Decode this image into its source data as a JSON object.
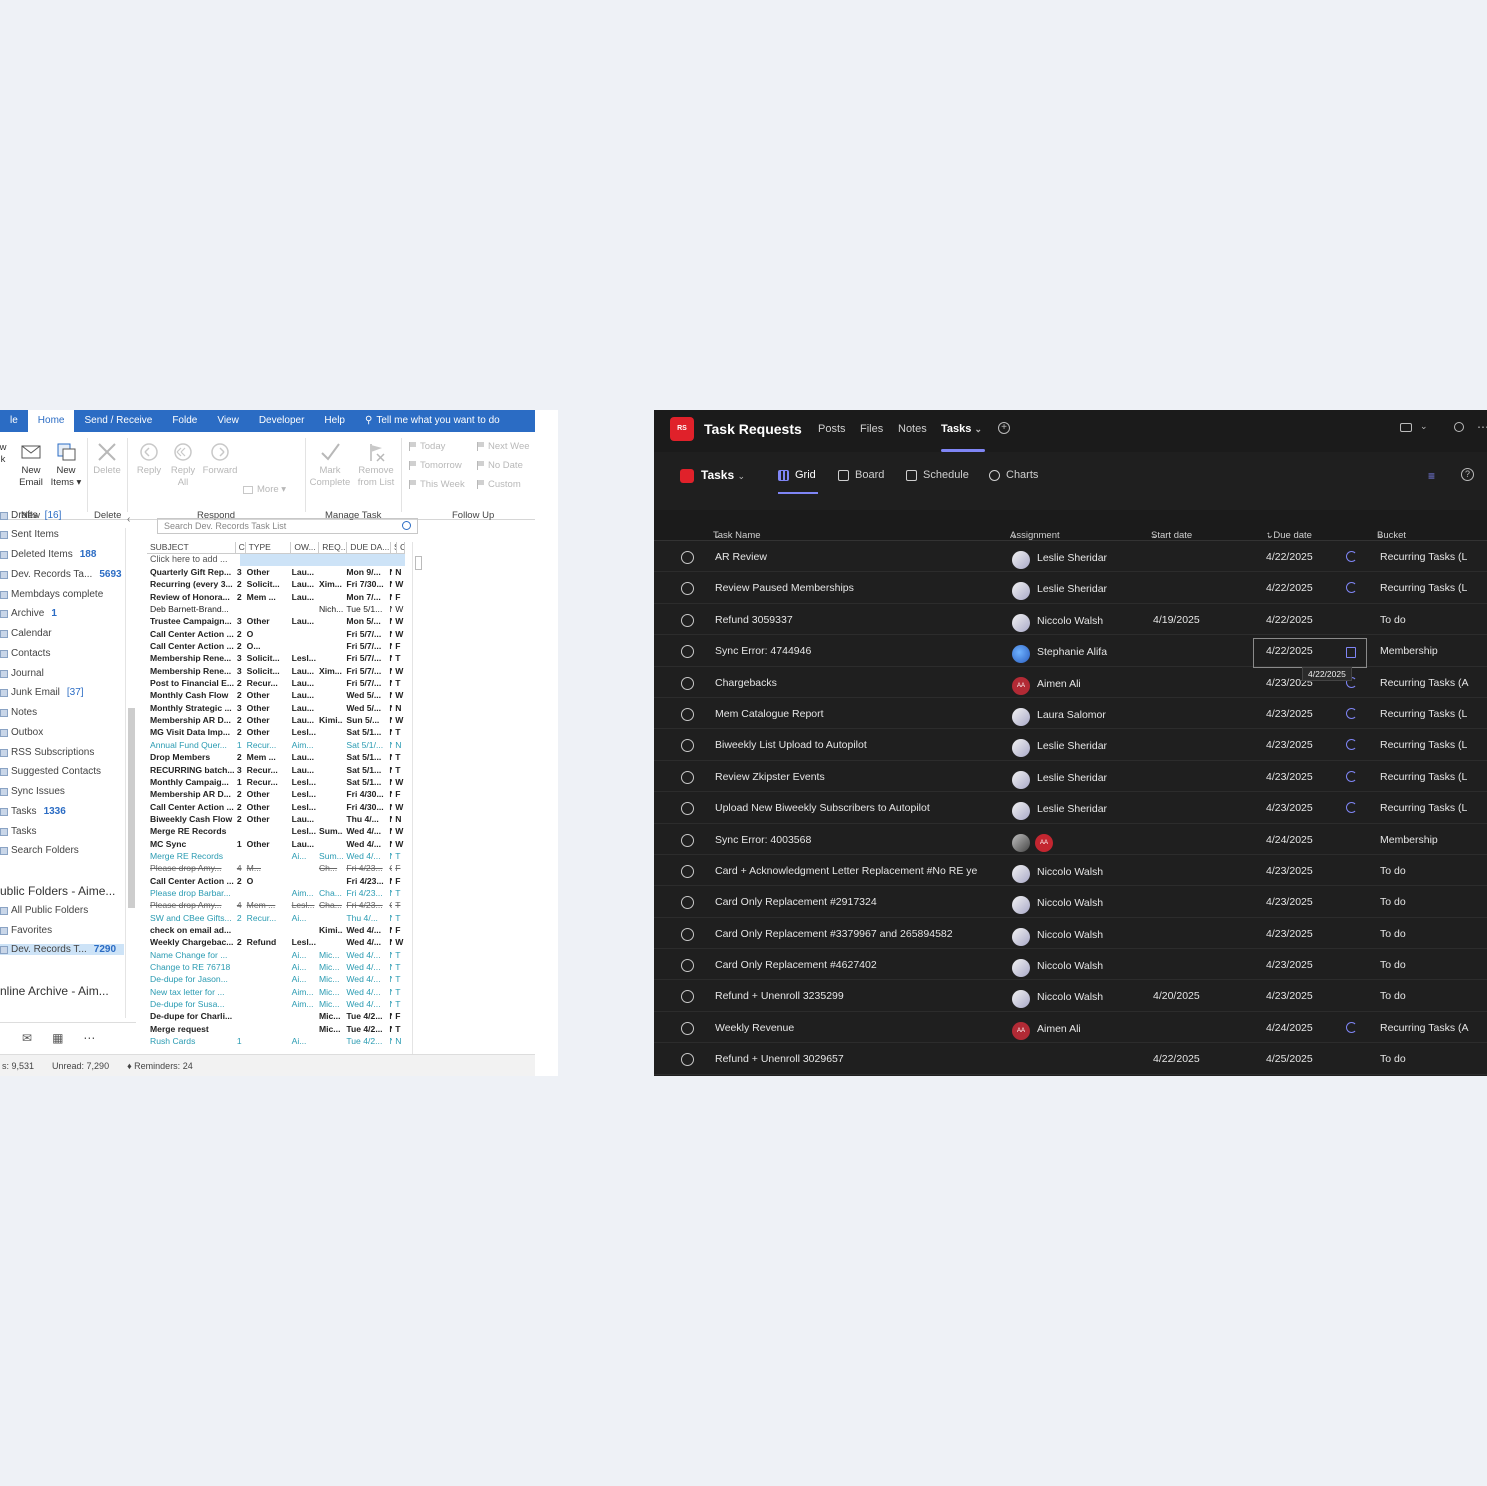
{
  "outlook": {
    "tabs": [
      "le",
      "Home",
      "Send / Receive",
      "Folde",
      "View",
      "Developer",
      "Help"
    ],
    "tell_me": "Tell me what you want to do",
    "ribbon": {
      "new_partial": "w\nk",
      "new_email": "New\nEmail",
      "new_items": "New\nItems ▾",
      "delete": "Delete",
      "reply": "Reply",
      "reply_all": "Reply\nAll",
      "forward": "Forward",
      "more": "More ▾",
      "mark_complete": "Mark\nComplete",
      "remove_from_list": "Remove\nfrom List",
      "today": "Today",
      "tomorrow": "Tomorrow",
      "this_week": "This Week",
      "next_week": "Next Wee",
      "no_date": "No Date",
      "custom": "Custom",
      "groups": [
        "New",
        "Delete",
        "Respond",
        "Manage Task",
        "Follow Up"
      ]
    },
    "folders": [
      {
        "label": "Drafts",
        "count": "[16]",
        "style": "br"
      },
      {
        "label": "Sent Items",
        "count": ""
      },
      {
        "label": "Deleted Items",
        "count": "188"
      },
      {
        "label": "Dev. Records Ta...",
        "count": "5693"
      },
      {
        "label": "Membdays complete",
        "count": ""
      },
      {
        "label": "Archive",
        "count": "1"
      },
      {
        "label": "Calendar",
        "count": ""
      },
      {
        "label": "Contacts",
        "count": ""
      },
      {
        "label": "Journal",
        "count": ""
      },
      {
        "label": "Junk Email",
        "count": "[37]",
        "style": "br"
      },
      {
        "label": "Notes",
        "count": ""
      },
      {
        "label": "Outbox",
        "count": ""
      },
      {
        "label": "RSS Subscriptions",
        "count": ""
      },
      {
        "label": "Suggested Contacts",
        "count": ""
      },
      {
        "label": "Sync Issues",
        "count": ""
      },
      {
        "label": "Tasks",
        "count": "1336"
      },
      {
        "label": "Tasks",
        "count": ""
      },
      {
        "label": "Search Folders",
        "count": ""
      }
    ],
    "public_header": "ublic Folders - Aime...",
    "public_folders": [
      {
        "label": "All Public Folders",
        "count": ""
      },
      {
        "label": "Favorites",
        "count": ""
      },
      {
        "label": "Dev. Records T...",
        "count": "7290"
      }
    ],
    "archive_header": "nline Archive - Aim...",
    "search_placeholder": "Search Dev. Records Task List",
    "columns": [
      "SUBJECT",
      "C",
      "TYPE",
      "OW...",
      "REQ...",
      "DUE DA...",
      "S",
      "C"
    ],
    "add_row": "Click here to add ...",
    "rows": [
      [
        "Quarterly Gift Rep...",
        "3",
        "Other",
        "Lau...",
        "",
        "Mon 9/...",
        "N",
        "N",
        "b"
      ],
      [
        "Recurring (every 3...",
        "2",
        "Solicit...",
        "Lau...",
        "Xim...",
        "Fri 7/30...",
        "N",
        "W",
        "b"
      ],
      [
        "Review of Honora...",
        "2",
        "Mem ...",
        "Lau...",
        "",
        "Mon 7/...",
        "N",
        "F",
        "b"
      ],
      [
        "Deb Barnett-Brand...",
        "",
        "",
        "",
        "Nich...",
        "Tue 5/1...",
        "N",
        "W",
        "n"
      ],
      [
        "Trustee Campaign...",
        "3",
        "Other",
        "Lau...",
        "",
        "Mon 5/...",
        "N",
        "W",
        "b"
      ],
      [
        "Call Center Action ...",
        "2",
        "O",
        "",
        "",
        "Fri 5/7/...",
        "N",
        "W",
        "b"
      ],
      [
        "Call Center Action ...",
        "2",
        "O...",
        "",
        "",
        "Fri 5/7/...",
        "N",
        "F",
        "b"
      ],
      [
        "Membership Rene...",
        "3",
        "Solicit...",
        "Lesl...",
        "",
        "Fri 5/7/...",
        "N",
        "T",
        "b"
      ],
      [
        "Membership Rene...",
        "3",
        "Solicit...",
        "Lau...",
        "Xim...",
        "Fri 5/7/...",
        "N",
        "W",
        "b"
      ],
      [
        "Post to Financial E...",
        "2",
        "Recur...",
        "Lau...",
        "",
        "Fri 5/7/...",
        "N",
        "T",
        "b"
      ],
      [
        "Monthly Cash Flow",
        "2",
        "Other",
        "Lau...",
        "",
        "Wed 5/...",
        "N",
        "W",
        "b"
      ],
      [
        "Monthly Strategic ...",
        "3",
        "Other",
        "Lau...",
        "",
        "Wed 5/...",
        "N",
        "N",
        "b"
      ],
      [
        "Membership AR D...",
        "2",
        "Other",
        "Lau...",
        "Kimi...",
        "Sun 5/...",
        "N",
        "W",
        "b"
      ],
      [
        "MG Visit Data Imp...",
        "2",
        "Other",
        "Lesl...",
        "",
        "Sat 5/1...",
        "N",
        "T",
        "b"
      ],
      [
        "Annual Fund Quer...",
        "1",
        "Recur...",
        "Aim...",
        "",
        "Sat 5/1/...",
        "N",
        "N",
        "t"
      ],
      [
        "Drop Members",
        "2",
        "Mem ...",
        "Lau...",
        "",
        "Sat 5/1...",
        "N",
        "T",
        "b"
      ],
      [
        "RECURRING batch...",
        "3",
        "Recur...",
        "Lau...",
        "",
        "Sat 5/1...",
        "N",
        "T",
        "b"
      ],
      [
        "Monthly Campaig...",
        "1",
        "Recur...",
        "Lesl...",
        "",
        "Sat 5/1...",
        "N",
        "W",
        "b"
      ],
      [
        "Membership AR D...",
        "2",
        "Other",
        "Lesl...",
        "",
        "Fri 4/30...",
        "N",
        "F",
        "b"
      ],
      [
        "Call Center Action ...",
        "2",
        "Other",
        "Lesl...",
        "",
        "Fri 4/30...",
        "N",
        "W",
        "b"
      ],
      [
        "Biweekly Cash Flow",
        "2",
        "Other",
        "Lau...",
        "",
        "Thu 4/...",
        "N",
        "N",
        "b"
      ],
      [
        "Merge RE Records",
        "",
        "",
        "Lesl...",
        "Sum...",
        "Wed 4/...",
        "N",
        "W",
        "b"
      ],
      [
        "MC Sync",
        "1",
        "Other",
        "Lau...",
        "",
        "Wed 4/...",
        "N",
        "W",
        "b"
      ],
      [
        "Merge RE Records",
        "",
        "",
        "Ai...",
        "Sum...",
        "Wed 4/...",
        "N",
        "T",
        "t"
      ],
      [
        "Please drop Amy...",
        "4",
        "M...",
        "",
        "Ch...",
        "Fri 4/23...",
        "C",
        "F",
        "s"
      ],
      [
        "Call Center Action ...",
        "2",
        "O",
        "",
        "",
        "Fri 4/23...",
        "N",
        "F",
        "b"
      ],
      [
        "Please drop Barbar...",
        "",
        "",
        "Aim...",
        "Cha...",
        "Fri 4/23...",
        "N",
        "T",
        "t"
      ],
      [
        "Please drop Amy...",
        "4",
        "Mem ...",
        "Lesl...",
        "Cha...",
        "Fri 4/23...",
        "C",
        "T",
        "s"
      ],
      [
        "SW and CBee Gifts...",
        "2",
        "Recur...",
        "Ai...",
        "",
        "Thu 4/...",
        "N",
        "T",
        "t"
      ],
      [
        "check on email ad...",
        "",
        "",
        "",
        "Kimi...",
        "Wed 4/...",
        "N",
        "F",
        "b"
      ],
      [
        "Weekly Chargebac...",
        "2",
        "Refund",
        "Lesl...",
        "",
        "Wed 4/...",
        "N",
        "W",
        "b"
      ],
      [
        "Name Change for ...",
        "",
        "",
        "Ai...",
        "Mic...",
        "Wed 4/...",
        "N",
        "T",
        "t"
      ],
      [
        "Change to RE 76718",
        "",
        "",
        "Ai...",
        "Mic...",
        "Wed 4/...",
        "N",
        "T",
        "t"
      ],
      [
        "De-dupe for Jason...",
        "",
        "",
        "Ai...",
        "Mic...",
        "Wed 4/...",
        "N",
        "T",
        "t"
      ],
      [
        "New tax letter for ...",
        "",
        "",
        "Aim...",
        "Mic...",
        "Wed 4/...",
        "N",
        "T",
        "t"
      ],
      [
        "De-dupe for Susa...",
        "",
        "",
        "Aim...",
        "Mic...",
        "Wed 4/...",
        "N",
        "T",
        "t"
      ],
      [
        "De-dupe for Charli...",
        "",
        "",
        "",
        "Mic...",
        "Tue 4/2...",
        "N",
        "F",
        "b"
      ],
      [
        "Merge request",
        "",
        "",
        "",
        "Mic...",
        "Tue 4/2...",
        "N",
        "T",
        "b"
      ],
      [
        "Rush Cards",
        "1",
        "",
        "Ai...",
        "",
        "Tue 4/2...",
        "N",
        "N",
        "t"
      ]
    ],
    "status": {
      "items": "s: 9,531",
      "unread": "Unread: 7,290",
      "reminders": "Reminders: 24"
    }
  },
  "teams": {
    "logo_text": "RS",
    "title": "Task Requests",
    "tabs": [
      "Posts",
      "Files",
      "Notes",
      "Tasks"
    ],
    "plan_label": "Tasks",
    "views": [
      "Grid",
      "Board",
      "Schedule",
      "Charts"
    ],
    "columns": {
      "task": "Task Name",
      "assignment": "Assignment",
      "start": "Start date",
      "due": "↑ Due date",
      "bucket": "Bucket"
    },
    "tooltip": "4/22/2025",
    "accent": "#7f85f5",
    "rows": [
      {
        "name": "AR Review",
        "assignee": "Leslie Sheridar",
        "av": "photo",
        "start": "",
        "due": "4/22/2025",
        "recur": true,
        "bucket": "Recurring Tasks (L"
      },
      {
        "name": "Review Paused Memberships",
        "assignee": "Leslie Sheridar",
        "av": "photo",
        "start": "",
        "due": "4/22/2025",
        "recur": true,
        "bucket": "Recurring Tasks (L"
      },
      {
        "name": "Refund 3059337",
        "assignee": "Niccolo Walsh",
        "av": "photo",
        "start": "4/19/2025",
        "due": "4/22/2025",
        "recur": false,
        "bucket": "To do"
      },
      {
        "name": "Sync Error: 4744946",
        "assignee": "Stephanie Alifa",
        "av": "blue",
        "start": "",
        "due": "4/22/2025",
        "recur": false,
        "bucket": "Membership"
      },
      {
        "name": "Chargebacks",
        "assignee": "Aimen Ali",
        "av": "red",
        "start": "",
        "due": "4/23/2025",
        "recur": true,
        "bucket": "Recurring Tasks (A"
      },
      {
        "name": "Mem Catalogue Report",
        "assignee": "Laura Salomor",
        "av": "photo",
        "start": "",
        "due": "4/23/2025",
        "recur": true,
        "bucket": "Recurring Tasks (L"
      },
      {
        "name": "Biweekly List Upload to Autopilot",
        "assignee": "Leslie Sheridar",
        "av": "photo",
        "start": "",
        "due": "4/23/2025",
        "recur": true,
        "bucket": "Recurring Tasks (L"
      },
      {
        "name": "Review Zkipster Events",
        "assignee": "Leslie Sheridar",
        "av": "photo",
        "start": "",
        "due": "4/23/2025",
        "recur": true,
        "bucket": "Recurring Tasks (L"
      },
      {
        "name": "Upload New Biweekly Subscribers to Autopilot",
        "assignee": "Leslie Sheridar",
        "av": "photo",
        "start": "",
        "due": "4/23/2025",
        "recur": true,
        "bucket": "Recurring Tasks (L"
      },
      {
        "name": "Sync Error: 4003568",
        "assignee": "",
        "av": "double",
        "start": "",
        "due": "4/24/2025",
        "recur": false,
        "bucket": "Membership"
      },
      {
        "name": "Card + Acknowledgment Letter Replacement #No RE ye",
        "assignee": "Niccolo Walsh",
        "av": "photo",
        "start": "",
        "due": "4/23/2025",
        "recur": false,
        "bucket": "To do"
      },
      {
        "name": "Card Only Replacement #2917324",
        "assignee": "Niccolo Walsh",
        "av": "photo",
        "start": "",
        "due": "4/23/2025",
        "recur": false,
        "bucket": "To do"
      },
      {
        "name": "Card Only Replacement #3379967 and 265894582",
        "assignee": "Niccolo Walsh",
        "av": "photo",
        "start": "",
        "due": "4/23/2025",
        "recur": false,
        "bucket": "To do"
      },
      {
        "name": "Card Only Replacement #4627402",
        "assignee": "Niccolo Walsh",
        "av": "photo",
        "start": "",
        "due": "4/23/2025",
        "recur": false,
        "bucket": "To do"
      },
      {
        "name": "Refund + Unenroll 3235299",
        "assignee": "Niccolo Walsh",
        "av": "photo",
        "start": "4/20/2025",
        "due": "4/23/2025",
        "recur": false,
        "bucket": "To do"
      },
      {
        "name": "Weekly Revenue",
        "assignee": "Aimen Ali",
        "av": "red",
        "start": "",
        "due": "4/24/2025",
        "recur": true,
        "bucket": "Recurring Tasks (A"
      },
      {
        "name": "Refund + Unenroll 3029657",
        "assignee": "",
        "av": "none",
        "start": "4/22/2025",
        "due": "4/25/2025",
        "recur": false,
        "bucket": "To do"
      }
    ],
    "avatar_initials": "AA"
  }
}
